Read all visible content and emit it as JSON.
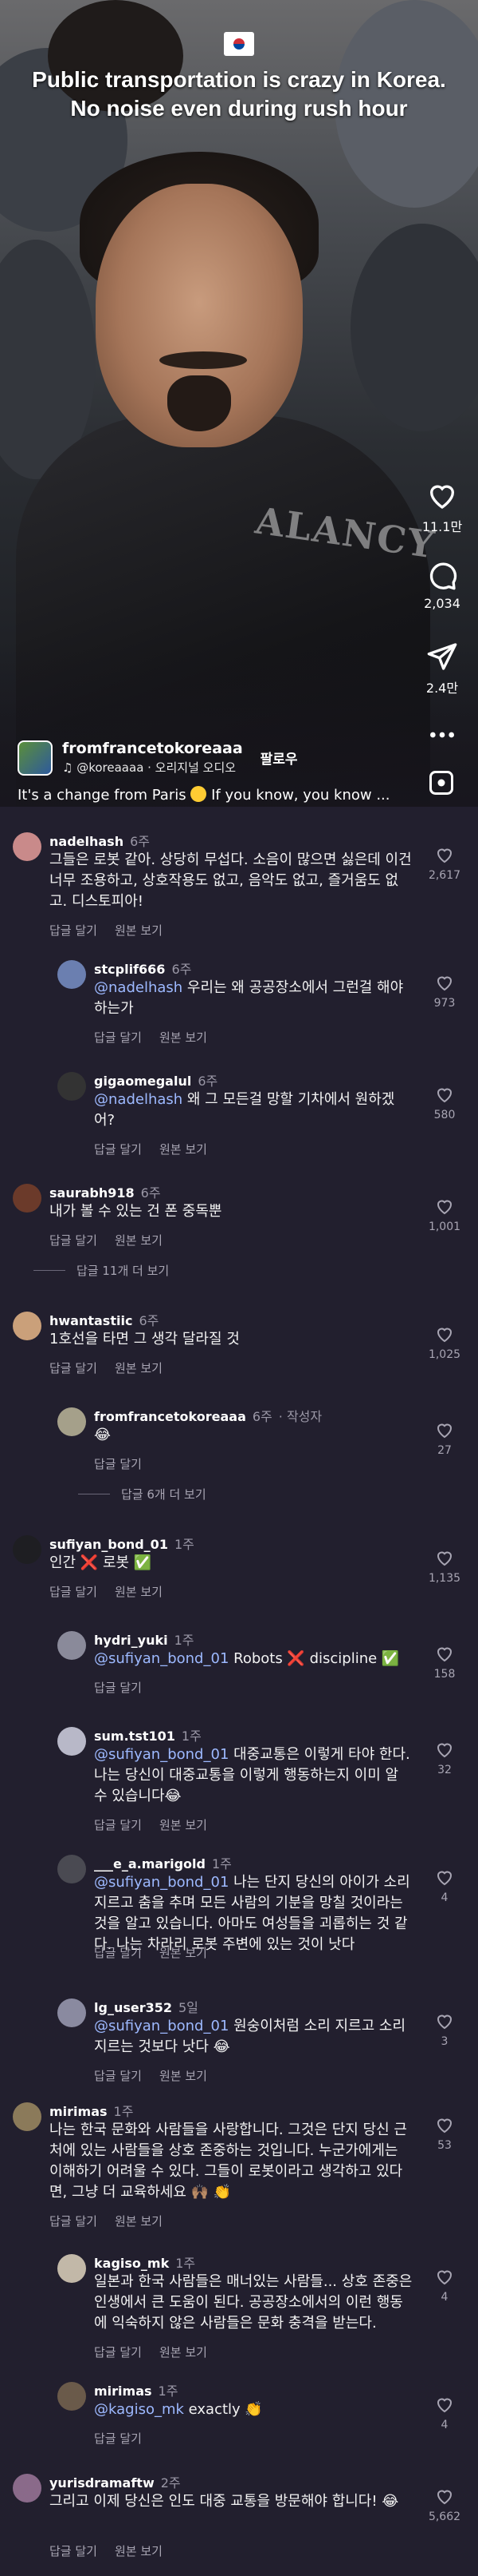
{
  "video": {
    "headline": "Public transportation is crazy in Korea. No noise even during rush hour",
    "shirt_print": "ALANCY",
    "likes": "11.1만",
    "comments": "2,034",
    "shares": "2.4만",
    "author": "fromfrancetokoreaaa",
    "audio": "@koreaaaa · 오리지널 오디오",
    "follow": "팔로우",
    "caption": "It's a change from Paris",
    "caption_more": "If you know, you know ..."
  },
  "comments": [
    {
      "user": "nadelhash",
      "time": "6주",
      "text": "그들은 로봇 같아. 상당히 무섭다. 소음이 많으면 싫은데 이건 너무 조용하고, 상호작용도 없고, 음악도 없고, 즐거움도 없고. 디스토피아!",
      "reply": "답글 달기",
      "translate": "원본 보기",
      "likes": "2,617"
    },
    {
      "user": "stcplif666",
      "time": "6주",
      "mention": "@nadelhash",
      "text": "우리는 왜 공공장소에서 그런걸 해야하는가",
      "reply": "답글 달기",
      "translate": "원본 보기",
      "likes": "973"
    },
    {
      "user": "gigaomegalul",
      "time": "6주",
      "mention": "@nadelhash",
      "text": "왜 그 모든걸 망할 기차에서 원하겠어?",
      "reply": "답글 달기",
      "translate": "원본 보기",
      "likes": "580"
    },
    {
      "user": "saurabh918",
      "time": "6주",
      "text": "내가 볼 수 있는 건 폰 중독뿐",
      "reply": "답글 달기",
      "translate": "원본 보기",
      "likes": "1,001",
      "more": "답글 11개 더 보기"
    },
    {
      "user": "hwantastiic",
      "time": "6주",
      "text": "1호선을 타면 그 생각 달라질 것",
      "reply": "답글 달기",
      "translate": "원본 보기",
      "likes": "1,025"
    },
    {
      "user": "fromfrancetokoreaaa",
      "time": "6주",
      "badge": "작성자",
      "text": "😂",
      "reply": "답글 달기",
      "likes": "27",
      "more": "답글 6개 더 보기"
    },
    {
      "user": "sufiyan_bond_01",
      "time": "1주",
      "text": "인간 ❌ 로봇 ✅",
      "reply": "답글 달기",
      "translate": "원본 보기",
      "likes": "1,135"
    },
    {
      "user": "hydri_yuki",
      "time": "1주",
      "mention": "@sufiyan_bond_01",
      "text": "Robots ❌ discipline ✅",
      "reply": "답글 달기",
      "likes": "158"
    },
    {
      "user": "sum.tst101",
      "time": "1주",
      "mention": "@sufiyan_bond_01",
      "text": "대중교통은 이렇게 타야 한다. 나는 당신이 대중교통을 이렇게 행동하는지 이미 알 수 있습니다😂",
      "reply": "답글 달기",
      "translate": "원본 보기",
      "likes": "32"
    },
    {
      "user": "___e_a.marigold",
      "time": "1주",
      "mention": "@sufiyan_bond_01",
      "text": "나는 단지 당신의 아이가 소리지르고 춤을 추며 모든 사람의 기분을 망칠 것이라는 것을 알고 있습니다. 아마도 여성들을 괴롭히는 것 같다. 나는 차라리 로봇 주변에 있는 것이 낫다",
      "reply": "답글 달기",
      "translate": "원본 보기",
      "likes": "4"
    },
    {
      "user": "lg_user352",
      "time": "5일",
      "mention": "@sufiyan_bond_01",
      "text": "원숭이처럼 소리 지르고 소리 지르는 것보다 낫다 😂",
      "reply": "답글 달기",
      "translate": "원본 보기",
      "likes": "3"
    },
    {
      "user": "mirimas",
      "time": "1주",
      "text": "나는 한국 문화와 사람들을 사랑합니다. 그것은 단지 당신 근처에 있는 사람들을 상호 존중하는 것입니다. 누군가에게는 이해하기 어려울 수 있다. 그들이 로봇이라고 생각하고 있다면, 그냥 더 교육하세요 🙌🏽 👏",
      "reply": "답글 달기",
      "translate": "원본 보기",
      "likes": "53"
    },
    {
      "user": "kagiso_mk",
      "time": "1주",
      "text": "일본과 한국 사람들은 매너있는 사람들... 상호 존중은 인생에서 큰 도움이 된다. 공공장소에서의 이런 행동에 익숙하지 않은 사람들은 문화 충격을 받는다.",
      "reply": "답글 달기",
      "translate": "원본 보기",
      "likes": "4"
    },
    {
      "user": "mirimas",
      "time": "1주",
      "mention": "@kagiso_mk",
      "text": "exactly 👏",
      "reply": "답글 달기",
      "likes": "4"
    },
    {
      "user": "yurisdramaftw",
      "time": "2주",
      "text": "그리고 이제 당신은 인도 대중 교통을 방문해야 합니다! 😂",
      "reply": "답글 달기",
      "translate": "원본 보기",
      "likes": "5,662"
    }
  ],
  "colors": {
    "background": "#221f2e",
    "mention": "#9db9ff",
    "muted": "#a8a5b3"
  }
}
